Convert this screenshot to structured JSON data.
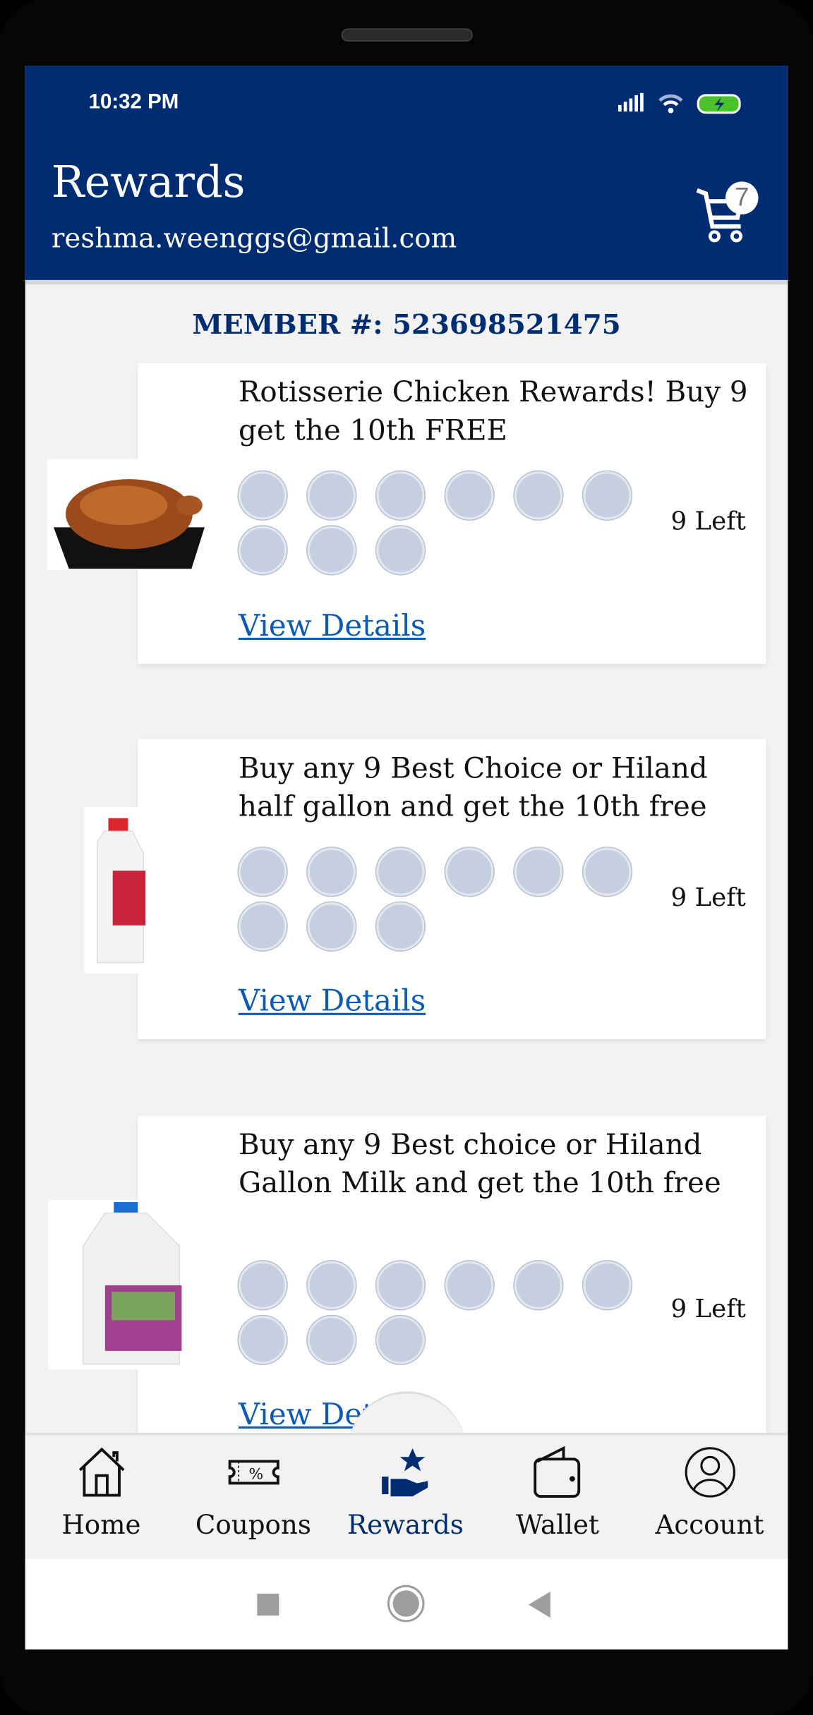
{
  "status_bar": {
    "time": "10:32 PM"
  },
  "header": {
    "title": "Rewards",
    "email": "reshma.weenggs@gmail.com",
    "cart_count": "7"
  },
  "member": {
    "label": "MEMBER #: 523698521475"
  },
  "rewards": [
    {
      "title": "Rotisserie Chicken Rewards! Buy 9 get the 10th FREE",
      "stamps_total": 9,
      "stamps_filled": 0,
      "left": "9 Left",
      "link": "View Details",
      "image": "rotisserie-chicken"
    },
    {
      "title": "Buy any 9 Best Choice or Hiland half gallon and get the 10th free",
      "stamps_total": 9,
      "stamps_filled": 0,
      "left": "9 Left",
      "link": "View Details",
      "image": "half-gallon-milk"
    },
    {
      "title": "Buy any 9 Best choice or Hiland Gallon Milk and get the 10th free",
      "stamps_total": 9,
      "stamps_filled": 0,
      "left": "9 Left",
      "link": "View Details",
      "image": "gallon-milk"
    }
  ],
  "bottom_nav": {
    "items": [
      {
        "label": "Home",
        "icon": "home-icon"
      },
      {
        "label": "Coupons",
        "icon": "coupon-icon"
      },
      {
        "label": "Rewards",
        "icon": "rewards-icon",
        "active": true
      },
      {
        "label": "Wallet",
        "icon": "wallet-icon"
      },
      {
        "label": "Account",
        "icon": "account-icon"
      }
    ]
  },
  "colors": {
    "brand": "#002d72",
    "link": "#0a5bb5",
    "stamp": "#c5cfdf"
  }
}
